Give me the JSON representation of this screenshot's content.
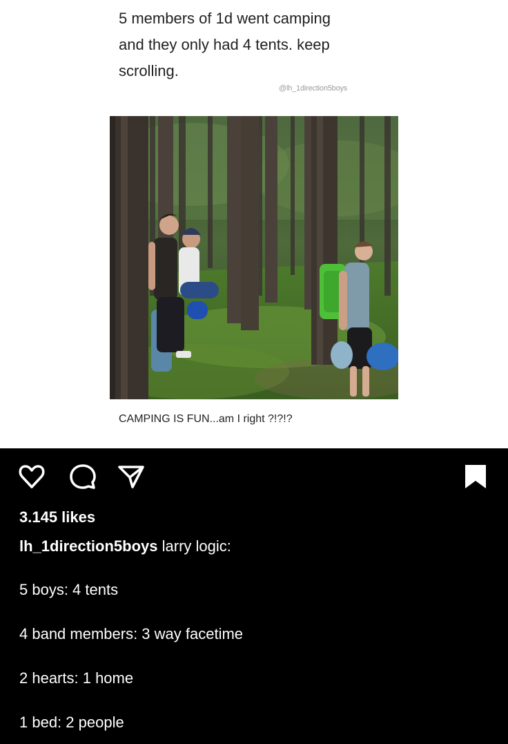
{
  "post_image": {
    "caption_lines": [
      "5 members of 1d went camping",
      "and they only had 4 tents. keep",
      "scrolling."
    ],
    "watermark": "@lh_1direction5boys",
    "photo_caption": "CAMPING IS FUN...am I right ?!?!?"
  },
  "actions": {
    "like_icon": "heart-outline",
    "comment_icon": "speech-bubble-outline",
    "share_icon": "paper-plane-outline",
    "save_icon": "bookmark-filled",
    "icon_color": "#ffffff"
  },
  "likes": "3.145 likes",
  "post_caption": {
    "username": "lh_1direction5boys",
    "text": "larry logic:",
    "lines": [
      "5 boys: 4 tents",
      "4 band members: 3 way facetime",
      "2 hearts: 1 home",
      "1 bed: 2 people"
    ]
  },
  "colors": {
    "background": "#000000",
    "text": "#ffffff",
    "card": "#ffffff"
  }
}
